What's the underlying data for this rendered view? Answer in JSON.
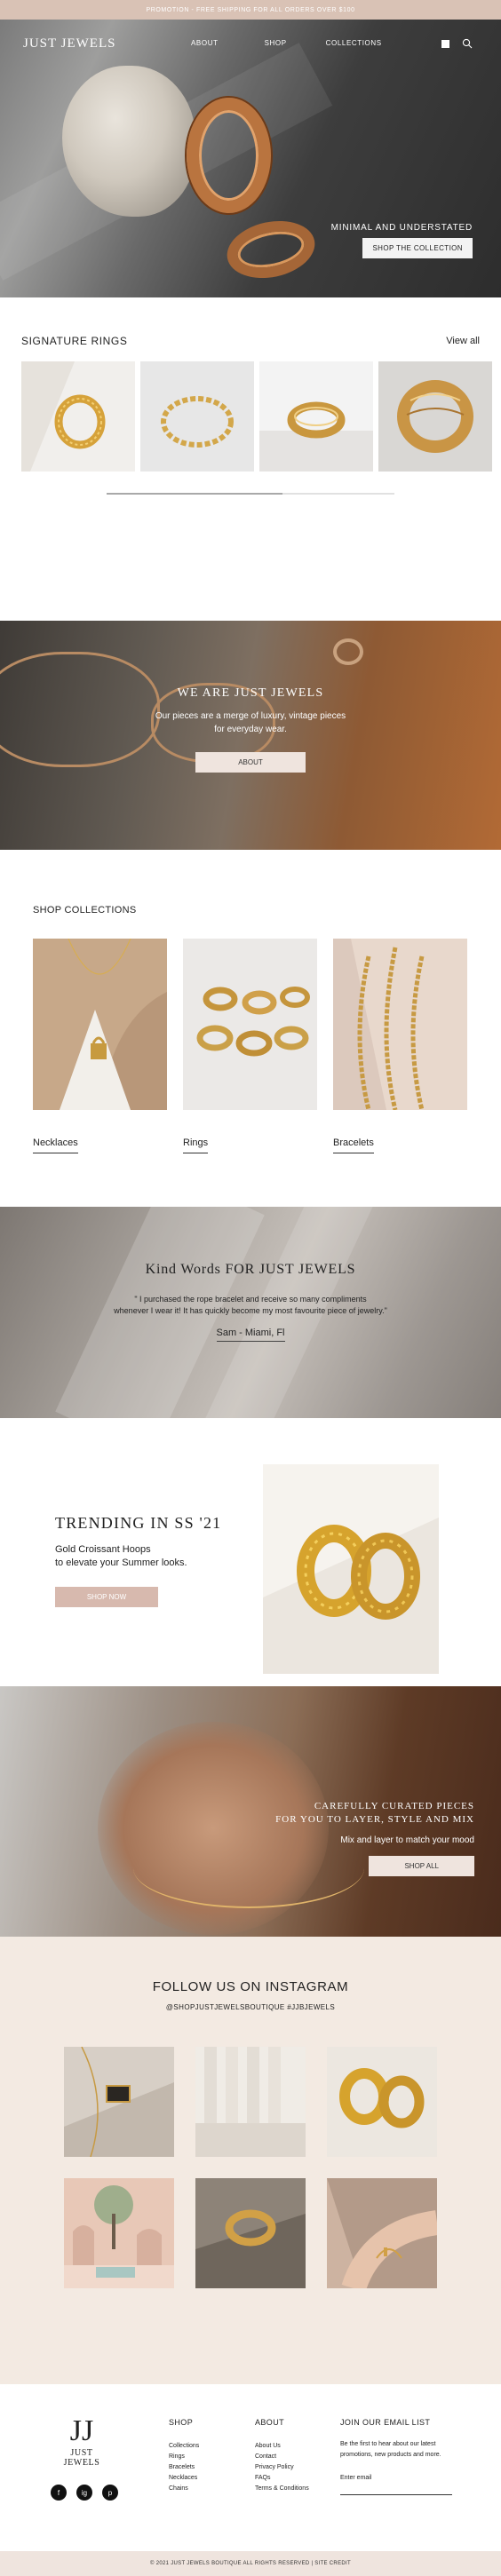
{
  "promo": {
    "text": "PROMOTION - FREE SHIPPING FOR ALL ORDERS OVER $100"
  },
  "nav": {
    "logo": "JUST JEWELS",
    "links": [
      "ABOUT",
      "SHOP",
      "COLLECTIONS"
    ],
    "icons": [
      "bag-icon",
      "search-icon"
    ]
  },
  "hero": {
    "tagline": "MINIMAL AND UNDERSTATED",
    "button": "SHOP THE COLLECTION"
  },
  "signature": {
    "title": "SIGNATURE RINGS",
    "view_all": "View all",
    "scroll_progress": 0.61
  },
  "about": {
    "title": "WE ARE JUST JEWELS",
    "text_line1": "Our pieces are a merge of luxury, vintage pieces",
    "text_line2": "for everyday wear.",
    "button": "ABOUT"
  },
  "collections": {
    "title": "SHOP COLLECTIONS",
    "items": [
      "Necklaces",
      "Rings",
      "Bracelets"
    ]
  },
  "testimonial": {
    "title": "Kind Words FOR JUST JEWELS",
    "quote_line1": "\" I purchased the rope bracelet and receive so many compliments",
    "quote_line2": "whenever I wear it! It has quickly become my most favourite piece of jewelry.\"",
    "author": "Sam - Miami, Fl"
  },
  "trending": {
    "title": "TRENDING IN SS '21",
    "line1": "Gold Croissant Hoops",
    "line2": "to elevate your Summer looks.",
    "button": "SHOP NOW"
  },
  "curated": {
    "title_line1": "CAREFULLY CURATED PIECES",
    "title_line2": "FOR YOU TO LAYER, STYLE AND MIX",
    "subtitle": "Mix and layer to match your mood",
    "button": "SHOP ALL"
  },
  "instagram": {
    "title": "FOLLOW US ON INSTAGRAM",
    "handles": "@SHOPJUSTJEWELSBOUTIQUE #JJBJEWELS"
  },
  "footer": {
    "logo_mark": "JJ",
    "logo_name": "JUST JEWELS",
    "socials": [
      "f",
      "ig",
      "p"
    ],
    "shop": {
      "heading": "SHOP",
      "items": [
        "Collections",
        "Rings",
        "Bracelets",
        "Necklaces",
        "Chains"
      ]
    },
    "about": {
      "heading": "ABOUT",
      "items": [
        "About Us",
        "Contact",
        "Privacy Policy",
        "FAQs",
        "Terms & Conditions"
      ]
    },
    "email": {
      "heading": "JOIN OUR EMAIL LIST",
      "text_line1": "Be the first to hear about our latest",
      "text_line2": "promotions, new products and more.",
      "label": "Enter email",
      "placeholder": ""
    },
    "copyright": "© 2021 JUST JEWELS BOUTIQUE ALL RIGHTS RESERVED  |  SITE CREDIT"
  },
  "colors": {
    "promo_bar": "#d9c2b5",
    "instagram_bg": "#f3eae2",
    "trend_button": "#d7b9ae",
    "copyright_bar": "#efe4de"
  }
}
